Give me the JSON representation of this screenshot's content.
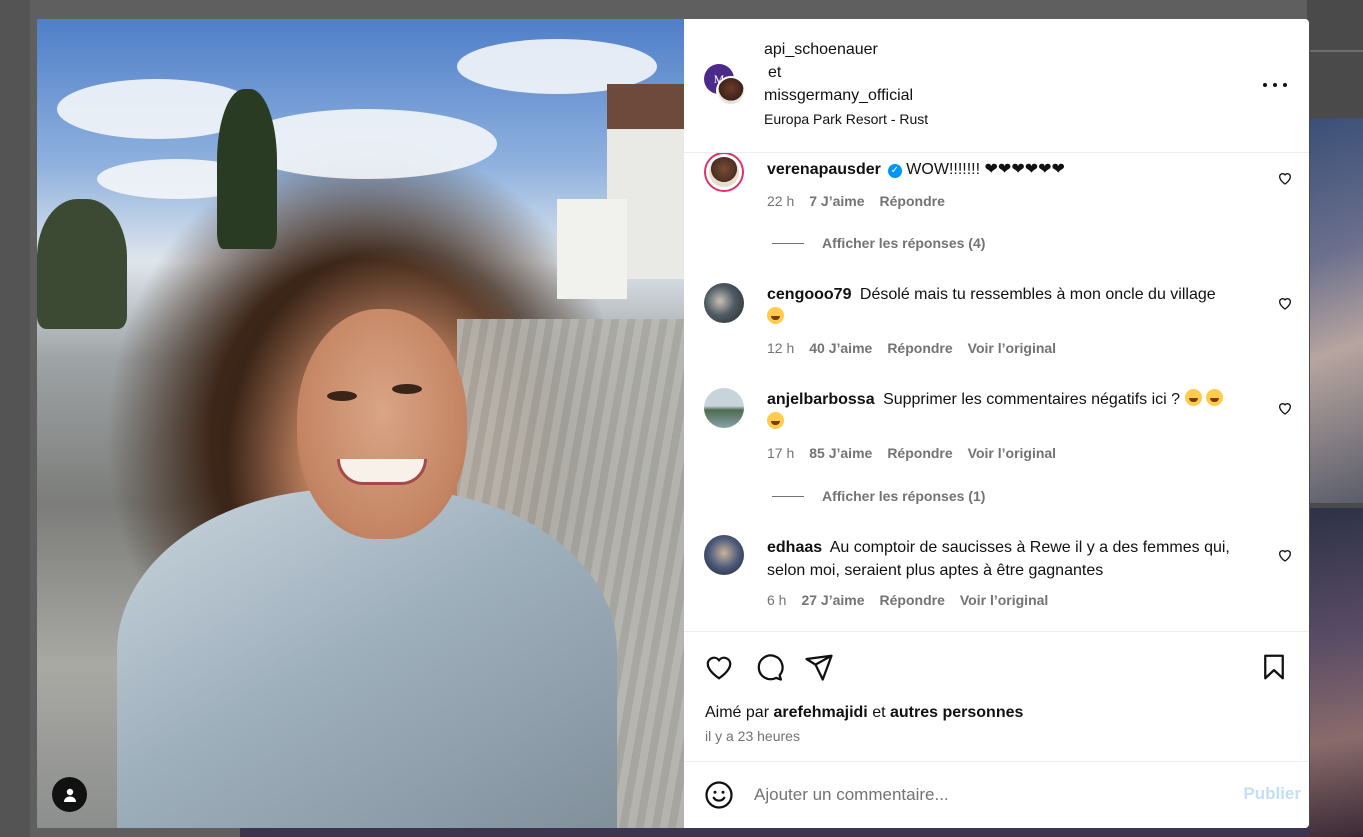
{
  "post": {
    "collaborators": {
      "user1": "api_schoenauer",
      "joiner": "et",
      "user2": "missgermany_official",
      "avatar1_initials": "M"
    },
    "location": "Europa Park Resort - Rust"
  },
  "comments": [
    {
      "user": "verenapausder",
      "verified": true,
      "text": "WOW!!!!!!! ❤❤❤❤❤❤",
      "time": "22 h",
      "likes": "7 J’aime",
      "reply": "Répondre",
      "view_replies": "Afficher les réponses (4)"
    },
    {
      "user": "cengooo79",
      "text": "Désolé mais tu ressembles à mon oncle du village",
      "time": "12 h",
      "likes": "40 J’aime",
      "reply": "Répondre",
      "see_original": "Voir l’original"
    },
    {
      "user": "anjelbarbossa",
      "text": "Supprimer les commentaires négatifs ici ?",
      "time": "17 h",
      "likes": "85 J’aime",
      "reply": "Répondre",
      "see_original": "Voir l’original",
      "view_replies": "Afficher les réponses (1)"
    },
    {
      "user": "edhaas",
      "text": "Au comptoir de saucisses à Rewe il y a des femmes qui, selon moi, seraient plus aptes à être gagnantes",
      "time": "6 h",
      "likes": "27 J’aime",
      "reply": "Répondre",
      "see_original": "Voir l’original"
    }
  ],
  "actions": {
    "liked_prefix": "Aimé par",
    "liked_user": "arefehmajidi",
    "liked_joiner": "et",
    "liked_others": "autres personnes",
    "time_ago": "il y a 23 heures"
  },
  "comment_box": {
    "placeholder": "Ajouter un commentaire...",
    "publish_label": "Publier"
  },
  "colors": {
    "accent_blue": "#0095f6",
    "publish_disabled": "#c3def7",
    "meta_gray": "#737373"
  },
  "icons": [
    "user-tag-icon",
    "more-icon",
    "heart-icon",
    "comment-icon",
    "share-icon",
    "bookmark-icon",
    "emoji-icon",
    "verified-icon"
  ]
}
